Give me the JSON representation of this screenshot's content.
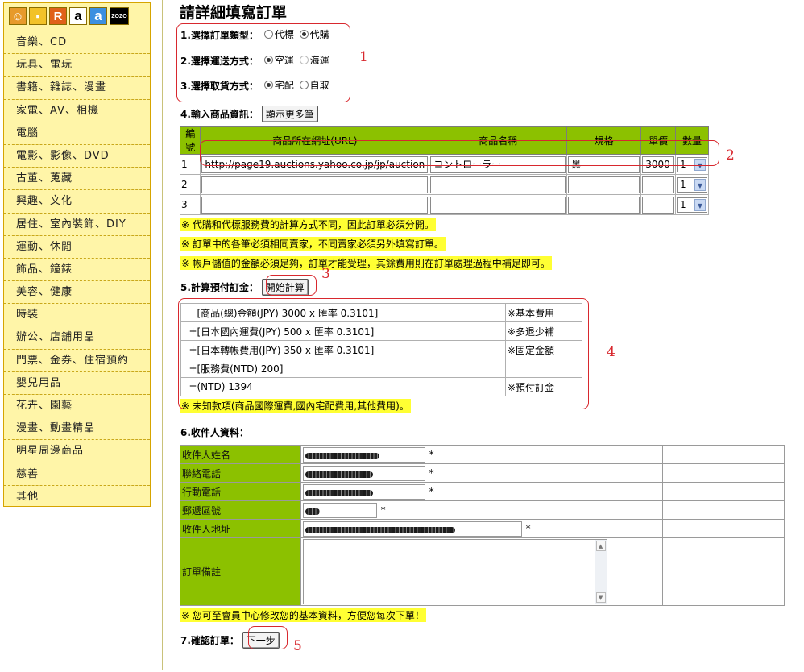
{
  "sidebar": {
    "icons": [
      {
        "name": "person-icon",
        "glyph": "☺"
      },
      {
        "name": "bag-icon",
        "glyph": "▪"
      },
      {
        "name": "rakuten-icon",
        "glyph": "R"
      },
      {
        "name": "amazon-icon",
        "glyph": "a"
      },
      {
        "name": "amazon-jp-icon",
        "glyph": "a"
      },
      {
        "name": "zozo-icon",
        "glyph": "ZOZO"
      }
    ],
    "items": [
      "音樂、CD",
      "玩具、電玩",
      "書籍、雜誌、漫畫",
      "家電、AV、相機",
      "電腦",
      "電影、影像、DVD",
      "古董、蒐藏",
      "興趣、文化",
      "居住、室內裝飾、DIY",
      "運動、休閒",
      "飾品、鐘錶",
      "美容、健康",
      "時裝",
      "辦公、店舖用品",
      "門票、金券、住宿預約",
      "嬰兒用品",
      "花卉、園藝",
      "漫畫、動畫精品",
      "明星周邊商品",
      "慈善",
      "其他"
    ]
  },
  "page": {
    "title": "請詳細填寫訂單"
  },
  "order_type": {
    "label": "1.選擇訂單類型：",
    "options": [
      "代標",
      "代購"
    ],
    "selected": "代購"
  },
  "shipping": {
    "label": "2.選擇運送方式：",
    "options": [
      "空運",
      "海運"
    ],
    "selected": "空運"
  },
  "pickup": {
    "label": "3.選擇取貨方式：",
    "options": [
      "宅配",
      "自取"
    ],
    "selected": "宅配"
  },
  "annotations": {
    "n1": "1",
    "n2": "2",
    "n3": "3",
    "n4": "4",
    "n5": "5"
  },
  "products": {
    "label": "4.輸入商品資訊：",
    "more_button": "顯示更多筆",
    "headers": [
      "編號",
      "商品所在網址(URL)",
      "商品名稱",
      "規格",
      "單價",
      "數量"
    ],
    "rows": [
      {
        "no": "1",
        "url": "http://page19.auctions.yahoo.co.jp/jp/auction",
        "name": "コントローラー",
        "spec": "黑",
        "price": "3000",
        "qty": "1"
      },
      {
        "no": "2",
        "url": "",
        "name": "",
        "spec": "",
        "price": "",
        "qty": "1"
      },
      {
        "no": "3",
        "url": "",
        "name": "",
        "spec": "",
        "price": "",
        "qty": "1"
      }
    ]
  },
  "notices": [
    "※  代購和代標服務費的計算方式不同，因此訂單必須分開。",
    "※  訂單中的各筆必須相同賣家，不同賣家必須另外填寫訂單。",
    "※  帳戶儲值的金額必須足夠，訂單才能受理，其餘費用則在訂單處理過程中補足即可。"
  ],
  "estimate": {
    "label": "5.計算預付訂金：",
    "button": "開始計算",
    "rows": [
      {
        "op": "",
        "text": "[商品(總)金額(JPY) 3000 x 匯率 0.3101]",
        "note": "※基本費用"
      },
      {
        "op": "+",
        "text": "[日本國內運費(JPY) 500 x 匯率 0.3101]",
        "note": "※多退少補"
      },
      {
        "op": "+",
        "text": "[日本轉帳費用(JPY) 350 x 匯率 0.3101]",
        "note": "※固定金額"
      },
      {
        "op": "+",
        "text": "[服務費(NTD) 200]",
        "note": ""
      },
      {
        "op": "=",
        "text": "(NTD) 1394",
        "note": "※預付訂金"
      }
    ],
    "footnote": "※  未知款項(商品國際運費,國內宅配費用,其他費用)。"
  },
  "recipient": {
    "label": "6.收件人資料：",
    "fields": [
      {
        "key": "name",
        "label": "收件人姓名",
        "required": "*"
      },
      {
        "key": "phone",
        "label": "聯絡電話",
        "required": "*"
      },
      {
        "key": "mobile",
        "label": "行動電話",
        "required": "*"
      },
      {
        "key": "zip",
        "label": "郵遞區號",
        "required": "*"
      },
      {
        "key": "address",
        "label": "收件人地址",
        "required": "*"
      },
      {
        "key": "remark",
        "label": "訂單備註",
        "required": ""
      }
    ],
    "footnote": "※  您可至會員中心修改您的基本資料，方便您每次下單！"
  },
  "confirm": {
    "label": "7.確認訂單：",
    "button": "下一步"
  },
  "colors": {
    "accent_green": "#8cc100",
    "sidebar_bg": "#fff5a8",
    "notice_yellow": "#ffff33",
    "annotation_red": "#d8282e"
  }
}
